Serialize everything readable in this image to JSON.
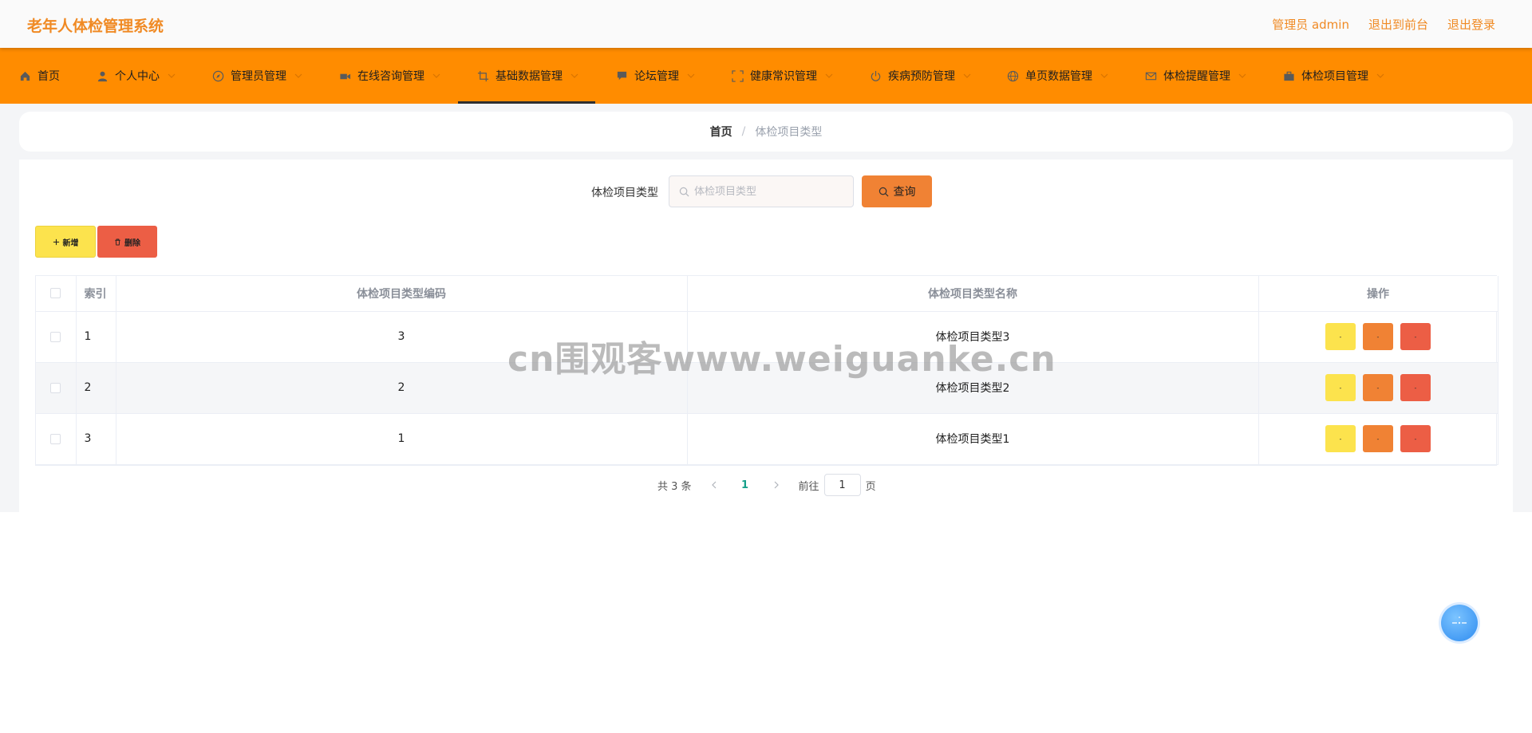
{
  "header": {
    "title": "老年人体检管理系统",
    "links": [
      "管理员 admin",
      "退出到前台",
      "退出登录"
    ]
  },
  "nav": {
    "items": [
      {
        "label": "首页",
        "icon": "home-icon"
      },
      {
        "label": "个人中心",
        "icon": "user-icon"
      },
      {
        "label": "管理员管理",
        "icon": "compass-icon"
      },
      {
        "label": "在线咨询管理",
        "icon": "video-icon"
      },
      {
        "label": "基础数据管理",
        "icon": "crop-icon"
      },
      {
        "label": "论坛管理",
        "icon": "chat-icon"
      },
      {
        "label": "健康常识管理",
        "icon": "fullscreen-icon"
      },
      {
        "label": "疾病预防管理",
        "icon": "power-icon"
      },
      {
        "label": "单页数据管理",
        "icon": "globe-icon"
      },
      {
        "label": "体检提醒管理",
        "icon": "mail-icon"
      },
      {
        "label": "体检项目管理",
        "icon": "briefcase-icon"
      }
    ],
    "active_index": 4
  },
  "breadcrumb": {
    "home": "首页",
    "separator": "/",
    "current": "体检项目类型"
  },
  "search": {
    "label": "体检项目类型",
    "placeholder": "体检项目类型",
    "value": "",
    "button": "查询"
  },
  "actions": {
    "add": "新增",
    "delete": "删除"
  },
  "table": {
    "columns": [
      "索引",
      "体检项目类型编码",
      "体检项目类型名称",
      "操作"
    ],
    "rows": [
      {
        "index": "1",
        "code": "3",
        "name": "体检项目类型3"
      },
      {
        "index": "2",
        "code": "2",
        "name": "体检项目类型2"
      },
      {
        "index": "3",
        "code": "1",
        "name": "体检项目类型1"
      }
    ],
    "op_labels": [
      "-",
      "-",
      "-"
    ]
  },
  "pagination": {
    "total": "共 3 条",
    "current_page": "1",
    "goto_label": "前往",
    "goto_value": "1",
    "page_suffix": "页"
  },
  "watermark": "cn围观客www.weiguanke.cn",
  "colors": {
    "brand": "#ff8c00",
    "title_orange": "#f08a24",
    "yellow": "#fce34d",
    "orange_btn": "#f08234",
    "red_btn": "#ec5e45",
    "page_active": "#16a08a"
  }
}
